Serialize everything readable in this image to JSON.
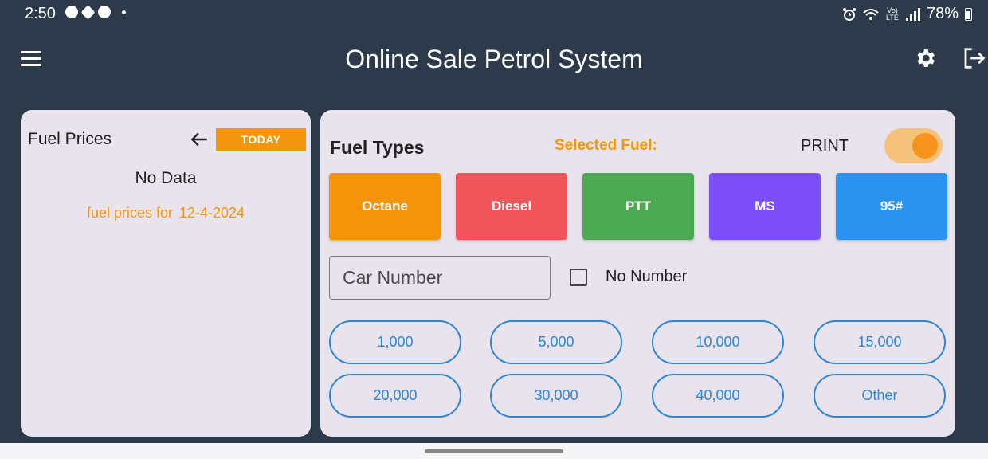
{
  "status_bar": {
    "time": "2:50",
    "battery": "78%",
    "icons_left": [
      "notification-icon",
      "app-icon",
      "chat-icon"
    ],
    "icons_right": [
      "alarm-icon",
      "wifi-icon",
      "volte-icon",
      "signal-icon",
      "battery-icon"
    ]
  },
  "app_bar": {
    "title": "Online Sale Petrol System",
    "menu_icon": "hamburger-icon",
    "settings_icon": "gear-icon",
    "logout_icon": "logout-icon"
  },
  "fuel_prices_panel": {
    "title": "Fuel Prices",
    "today_label": "TODAY",
    "empty_message": "No Data",
    "prices_for_label": "fuel prices for",
    "prices_date": "12-4-2024"
  },
  "fuel_types_panel": {
    "title": "Fuel Types",
    "selected_label": "Selected Fuel:",
    "print_label": "PRINT",
    "print_enabled": true,
    "fuel_types": [
      {
        "label": "Octane",
        "color": "#f5940b"
      },
      {
        "label": "Diesel",
        "color": "#f1545b"
      },
      {
        "label": "PTT",
        "color": "#4caa53"
      },
      {
        "label": "MS",
        "color": "#7c4ff8"
      },
      {
        "label": "95#",
        "color": "#2b94ee"
      }
    ],
    "car_number_placeholder": "Car Number",
    "no_number_label": "No Number",
    "no_number_checked": false,
    "amounts": [
      "1,000",
      "5,000",
      "10,000",
      "15,000",
      "20,000",
      "30,000",
      "40,000",
      "Other"
    ]
  },
  "colors": {
    "background": "#2c3a4b",
    "panel": "#e9e3ee",
    "accent_orange": "#f2960e",
    "accent_blue": "#2e86d6"
  }
}
